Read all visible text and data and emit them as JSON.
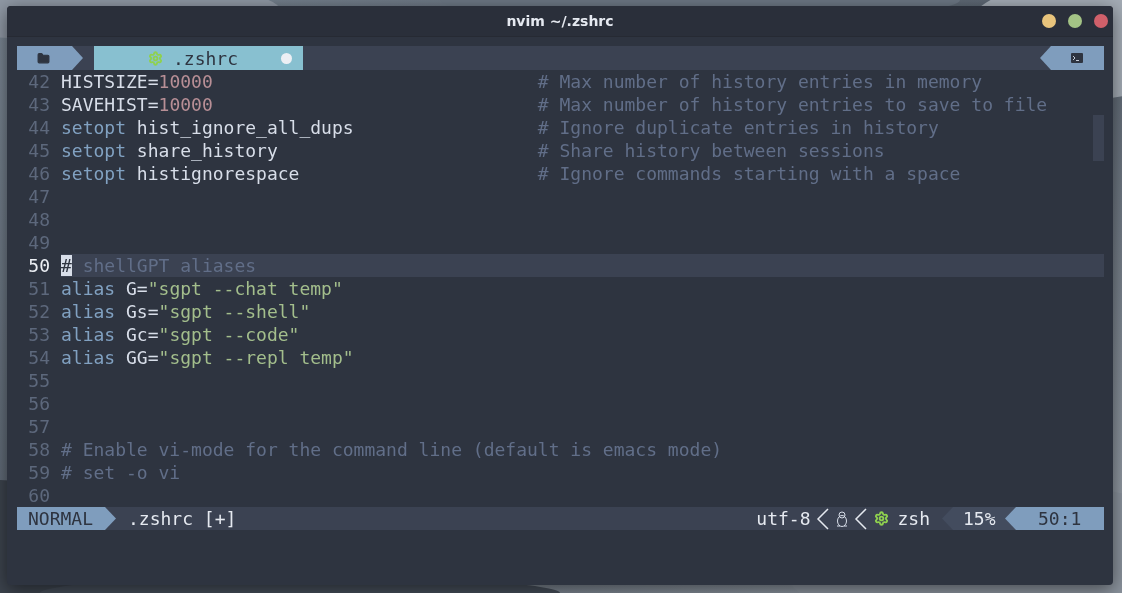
{
  "window": {
    "title": "nvim ~/.zshrc",
    "controls": [
      {
        "color": "#e8c47c"
      },
      {
        "color": "#a3c385"
      },
      {
        "color": "#d0606a"
      }
    ]
  },
  "tabline": {
    "tab": {
      "label": ".zshrc",
      "modified": true
    }
  },
  "lines": [
    {
      "number": "42",
      "current": false,
      "code": [
        {
          "kind": "plain",
          "text": "HISTSIZE="
        },
        {
          "kind": "number",
          "text": "10000"
        }
      ],
      "comment": "# Max number of history entries in memory"
    },
    {
      "number": "43",
      "current": false,
      "code": [
        {
          "kind": "plain",
          "text": "SAVEHIST="
        },
        {
          "kind": "number",
          "text": "10000"
        }
      ],
      "comment": "# Max number of history entries to save to file"
    },
    {
      "number": "44",
      "current": false,
      "code": [
        {
          "kind": "keyword",
          "text": "setopt"
        },
        {
          "kind": "plain",
          "text": " hist_ignore_all_dups"
        }
      ],
      "comment": "# Ignore duplicate entries in history"
    },
    {
      "number": "45",
      "current": false,
      "code": [
        {
          "kind": "keyword",
          "text": "setopt"
        },
        {
          "kind": "plain",
          "text": " share_history"
        }
      ],
      "comment": "# Share history between sessions"
    },
    {
      "number": "46",
      "current": false,
      "code": [
        {
          "kind": "keyword",
          "text": "setopt"
        },
        {
          "kind": "plain",
          "text": " histignorespace"
        }
      ],
      "comment": "# Ignore commands starting with a space"
    },
    {
      "number": "47",
      "current": false
    },
    {
      "number": "48",
      "current": false
    },
    {
      "number": "49",
      "current": false
    },
    {
      "number": "50",
      "current": true,
      "code": [
        {
          "kind": "cursor",
          "text": "#"
        },
        {
          "kind": "comment",
          "text": " shellGPT aliases"
        }
      ]
    },
    {
      "number": "51",
      "current": false,
      "code": [
        {
          "kind": "keyword",
          "text": "alias"
        },
        {
          "kind": "plain",
          "text": " G="
        },
        {
          "kind": "string",
          "text": "\"sgpt --chat temp\""
        }
      ]
    },
    {
      "number": "52",
      "current": false,
      "code": [
        {
          "kind": "keyword",
          "text": "alias"
        },
        {
          "kind": "plain",
          "text": " Gs="
        },
        {
          "kind": "string",
          "text": "\"sgpt --shell\""
        }
      ]
    },
    {
      "number": "53",
      "current": false,
      "code": [
        {
          "kind": "keyword",
          "text": "alias"
        },
        {
          "kind": "plain",
          "text": " Gc="
        },
        {
          "kind": "string",
          "text": "\"sgpt --code\""
        }
      ]
    },
    {
      "number": "54",
      "current": false,
      "code": [
        {
          "kind": "keyword",
          "text": "alias"
        },
        {
          "kind": "plain",
          "text": " GG="
        },
        {
          "kind": "string",
          "text": "\"sgpt --repl temp\""
        }
      ]
    },
    {
      "number": "55",
      "current": false
    },
    {
      "number": "56",
      "current": false
    },
    {
      "number": "57",
      "current": false
    },
    {
      "number": "58",
      "current": false,
      "code": [
        {
          "kind": "comment",
          "text": "# Enable vi-mode for the command line (default is emacs mode)"
        }
      ]
    },
    {
      "number": "59",
      "current": false,
      "code": [
        {
          "kind": "comment",
          "text": "# set -o vi"
        }
      ]
    },
    {
      "number": "60",
      "current": false
    }
  ],
  "statusline": {
    "mode": "NORMAL",
    "file": ".zshrc [+]",
    "encoding": "utf-8",
    "filetype": "zsh",
    "percent": "15%",
    "position": "50:1"
  }
}
